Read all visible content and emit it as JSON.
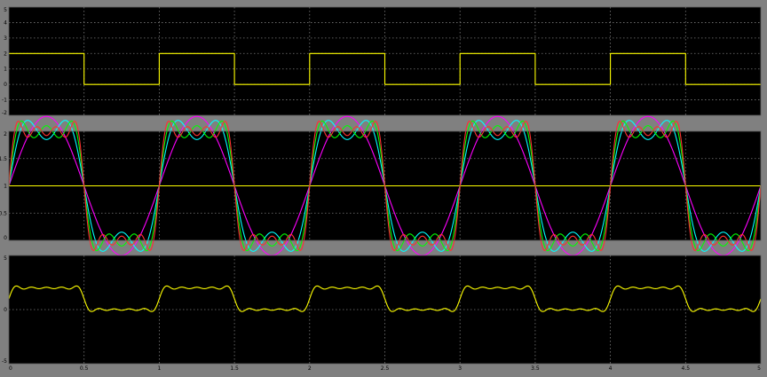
{
  "colors": {
    "background": "#808080",
    "plot_background": "#000000",
    "grid": "#7a7a7a",
    "axis_text": "#000000"
  },
  "chart_data": [
    {
      "type": "line",
      "title": "",
      "xlabel": "",
      "ylabel": "",
      "grid": true,
      "xlim": [
        0,
        5
      ],
      "ylim": [
        -2,
        5
      ],
      "x_ticks": [
        "0",
        "0.5",
        "1",
        "1.5",
        "2",
        "2.5",
        "3",
        "3.5",
        "4",
        "4.5",
        "5"
      ],
      "y_ticks": [
        "-2",
        "-1",
        "0",
        "1",
        "2",
        "3",
        "4",
        "5"
      ],
      "series": [
        {
          "color": "#ffff00",
          "style": "step",
          "x": [
            0,
            0.5,
            0.5,
            1,
            1,
            1.5,
            1.5,
            2,
            2,
            2.5,
            2.5,
            3,
            3,
            3.5,
            3.5,
            4,
            4,
            4.5,
            4.5,
            5
          ],
          "y": [
            2,
            2,
            0,
            0,
            2,
            2,
            0,
            0,
            2,
            2,
            0,
            0,
            2,
            2,
            0,
            0,
            2,
            2,
            0,
            0
          ]
        }
      ]
    },
    {
      "type": "line",
      "title": "",
      "xlabel": "",
      "ylabel": "",
      "grid": true,
      "xlim": [
        0,
        5
      ],
      "ylim": [
        0,
        2
      ],
      "x_ticks": [
        "0",
        "0.5",
        "1",
        "1.5",
        "2",
        "2.5",
        "3",
        "3.5",
        "4",
        "4.5",
        "5"
      ],
      "y_ticks": [
        "0",
        "0.5",
        "1",
        "1.5",
        "2"
      ],
      "series": [
        {
          "color": "#ffff00",
          "x": [
            0,
            5
          ],
          "y": [
            1,
            1
          ]
        },
        {
          "color": "#ff00ff",
          "type": "fourier_partial_sum",
          "harmonics": 1,
          "period": 1,
          "offset": 1
        },
        {
          "color": "#00ffff",
          "type": "fourier_partial_sum",
          "harmonics": 3,
          "period": 1,
          "offset": 1
        },
        {
          "color": "#00ff00",
          "type": "fourier_partial_sum",
          "harmonics": 5,
          "period": 1,
          "offset": 1
        },
        {
          "color": "#ff3030",
          "type": "fourier_partial_sum",
          "harmonics": 7,
          "period": 1,
          "offset": 1
        }
      ]
    },
    {
      "type": "line",
      "title": "",
      "xlabel": "",
      "ylabel": "",
      "grid": true,
      "xlim": [
        0,
        5
      ],
      "ylim": [
        -5,
        5
      ],
      "x_ticks": [
        "0",
        "0.5",
        "1",
        "1.5",
        "2",
        "2.5",
        "3",
        "3.5",
        "4",
        "4.5",
        "5"
      ],
      "y_ticks": [
        "-5",
        "0",
        "5"
      ],
      "series": [
        {
          "color": "#ffff00",
          "type": "fourier_partial_sum",
          "harmonics": 9,
          "period": 1,
          "offset": 1
        }
      ]
    }
  ]
}
